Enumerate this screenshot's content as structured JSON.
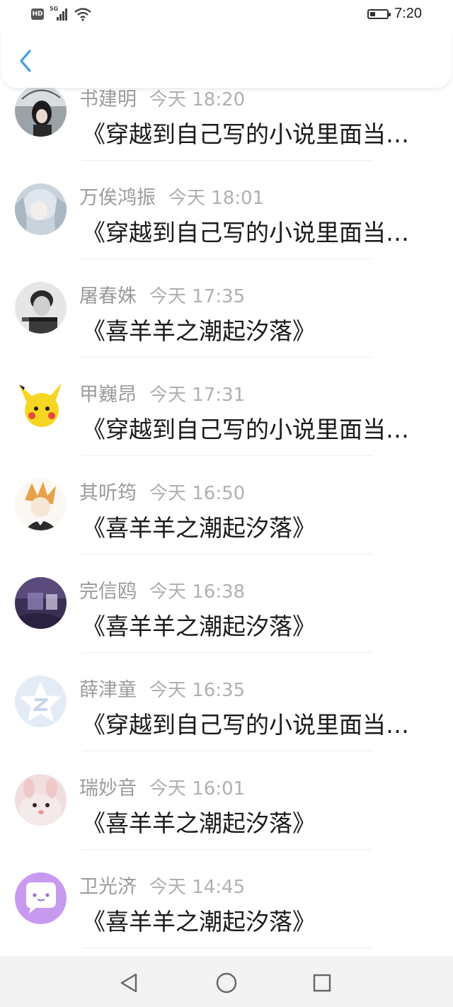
{
  "status_bar": {
    "hd_label": "HD",
    "network_label": "5G",
    "time": "7:20",
    "battery_level": 0.3
  },
  "header": {
    "back_icon": "chevron-left-icon"
  },
  "messages": [
    {
      "name": "书建明",
      "time": "今天 18:20",
      "text": "《穿越到自己写的小说里面当炮灰》"
    },
    {
      "name": "万俟鸿振",
      "time": "今天 18:01",
      "text": "《穿越到自己写的小说里面当炮灰》"
    },
    {
      "name": "屠春姝",
      "time": "今天 17:35",
      "text": "《喜羊羊之潮起汐落》"
    },
    {
      "name": "甲巍昂",
      "time": "今天 17:31",
      "text": "《穿越到自己写的小说里面当炮灰》"
    },
    {
      "name": "其听筠",
      "time": "今天 16:50",
      "text": "《喜羊羊之潮起汐落》"
    },
    {
      "name": "完信鸥",
      "time": "今天 16:38",
      "text": "《喜羊羊之潮起汐落》"
    },
    {
      "name": "薛津童",
      "time": "今天 16:35",
      "text": "《穿越到自己写的小说里面当炮灰》"
    },
    {
      "name": "瑞妙音",
      "time": "今天 16:01",
      "text": "《喜羊羊之潮起汐落》"
    },
    {
      "name": "卫光济",
      "time": "今天 14:45",
      "text": "《喜羊羊之潮起汐落》"
    }
  ],
  "nav_bar": {
    "back": "triangle-back-icon",
    "home": "circle-home-icon",
    "recents": "square-recents-icon"
  },
  "colors": {
    "accent": "#3aa0e6",
    "name": "#9b9b9b",
    "message": "#1a1a1a"
  }
}
